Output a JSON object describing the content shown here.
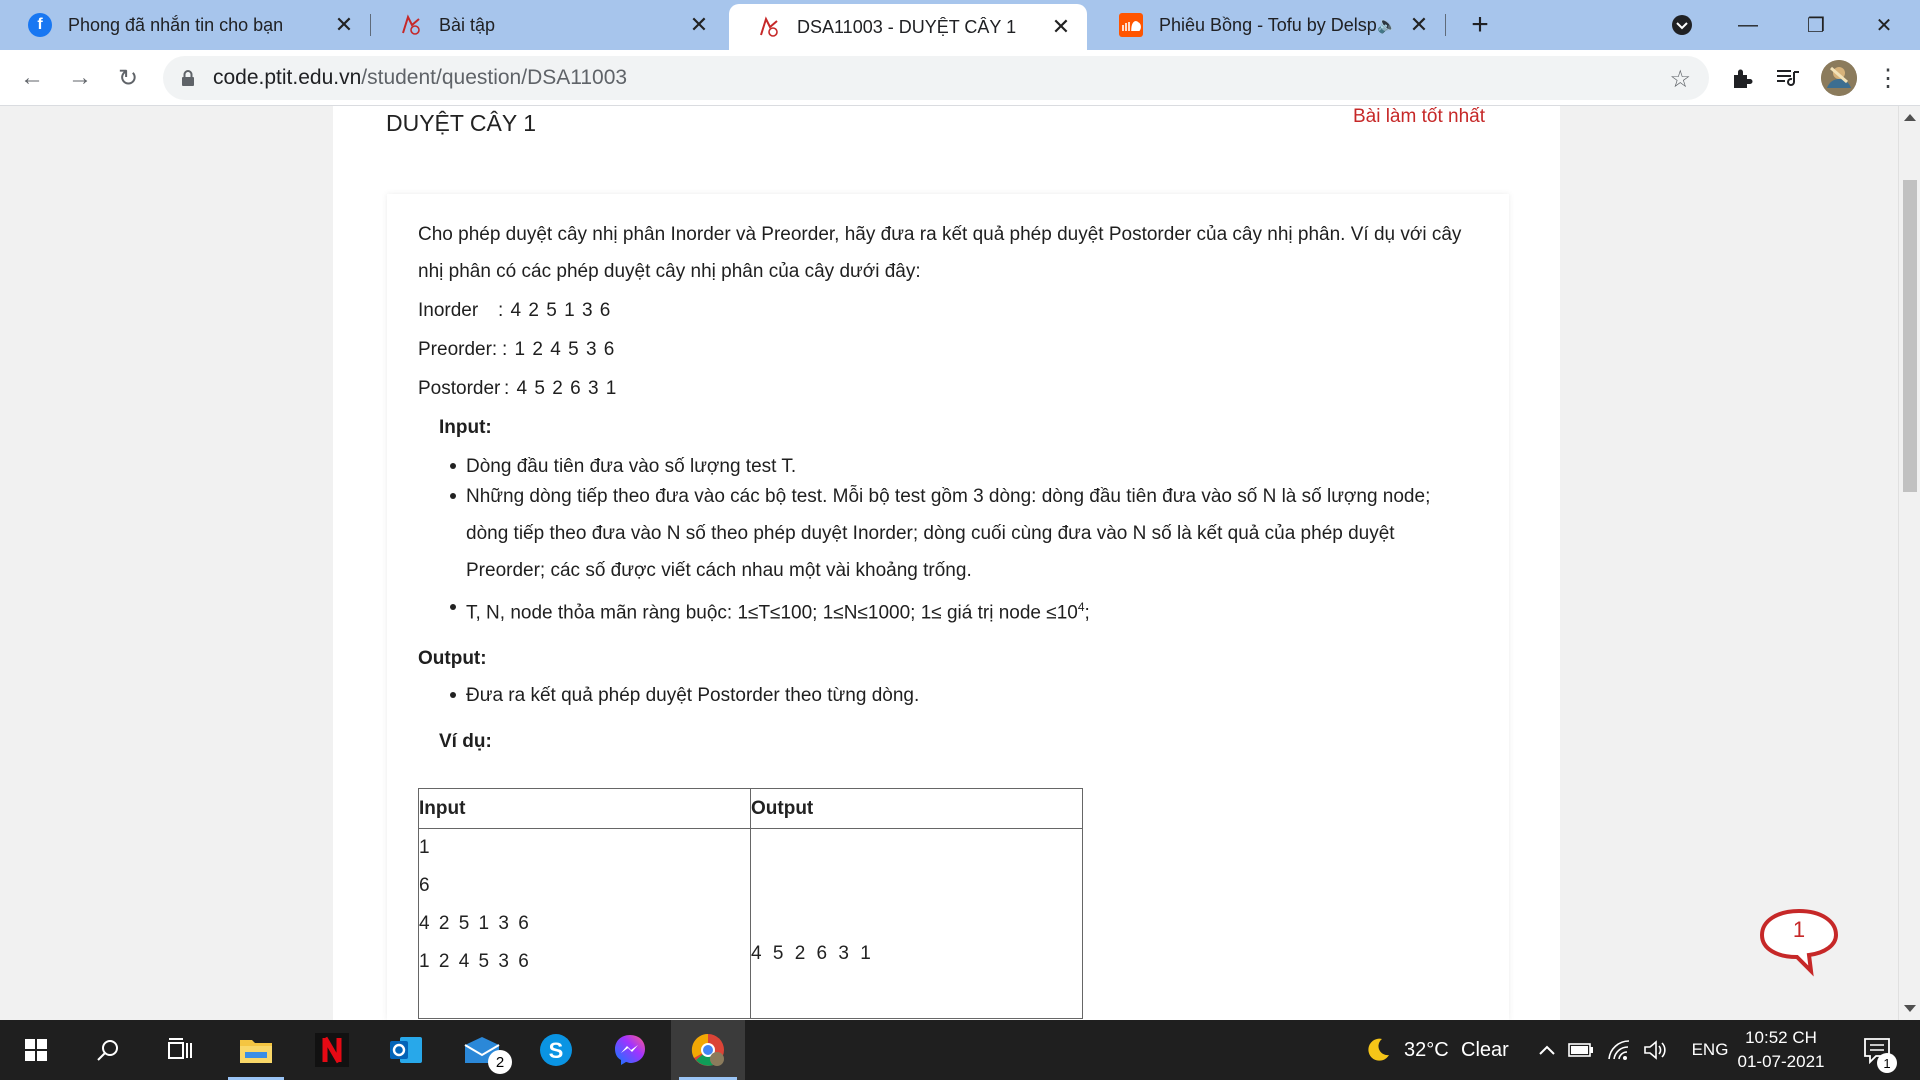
{
  "browser": {
    "tabs": [
      {
        "title": "Phong đã nhắn tin cho bạn",
        "favicon": "facebook-icon",
        "active": false
      },
      {
        "title": "Bài tập",
        "favicon": "ptit-logo-icon",
        "active": false
      },
      {
        "title": "DSA11003 - DUYỆT CÂY 1",
        "favicon": "ptit-logo-icon",
        "active": true
      },
      {
        "title": "Phiêu Bồng - Tofu by Delspx",
        "favicon": "soundcloud-icon",
        "active": false,
        "audio": "speaker-icon"
      }
    ],
    "url_host": "code.ptit.edu.vn",
    "url_path": "/student/question/DSA11003"
  },
  "page": {
    "problem_title": "DUYỆT CÂY 1",
    "best_link": "Bài làm tốt nhất",
    "intro": "Cho phép duyệt cây nhị phân Inorder và Preorder, hãy đưa ra kết quả phép duyệt Postorder của cây nhị phân. Ví dụ với cây nhị phân có các phép duyệt cây nhị phân của cây dưới đây:",
    "inorder_label": "Inorder",
    "inorder_values": ": 4  2  5  1  3  6",
    "preorder_label": "Preorder:",
    "preorder_values": ": 1  2  4  5  3  6",
    "postorder_label": "Postorder",
    "postorder_values": ": 4  5  2  6  3  1",
    "input_heading": "Input:",
    "input_items": [
      "Dòng đầu tiên đưa vào số lượng test T.",
      "Những dòng tiếp theo đưa vào các bộ test. Mỗi bộ test gồm 3 dòng: dòng đầu tiên đưa vào số N là số lượng node; dòng tiếp theo đưa vào N số theo phép duyệt Inorder; dòng cuối cùng đưa vào N số là kết quả của phép duyệt Preorder; các số được viết cách nhau một vài khoảng trống."
    ],
    "constraint_prefix": "T, N, node thỏa mãn ràng buộc: 1≤T≤100; 1≤N≤1000; 1≤ giá trị node ≤10",
    "constraint_sup": "4",
    "constraint_suffix": ";",
    "output_heading": "Output:",
    "output_items": [
      "Đưa ra kết quả phép duyệt Postorder theo từng dòng."
    ],
    "example_heading": "Ví dụ:",
    "table": {
      "headers": [
        "Input",
        "Output"
      ],
      "input_lines": [
        "1",
        "6",
        "4 2 5 1 3 6",
        "1 2 4 5 3 6"
      ],
      "output": "4 5 2 6 3 1"
    },
    "chat_badge": "1"
  },
  "taskbar": {
    "mail_badge": "2",
    "weather_temp": "32°C",
    "weather_text": "Clear",
    "language": "ENG",
    "time": "10:52 CH",
    "date": "01-07-2021",
    "notification_badge": "1"
  }
}
